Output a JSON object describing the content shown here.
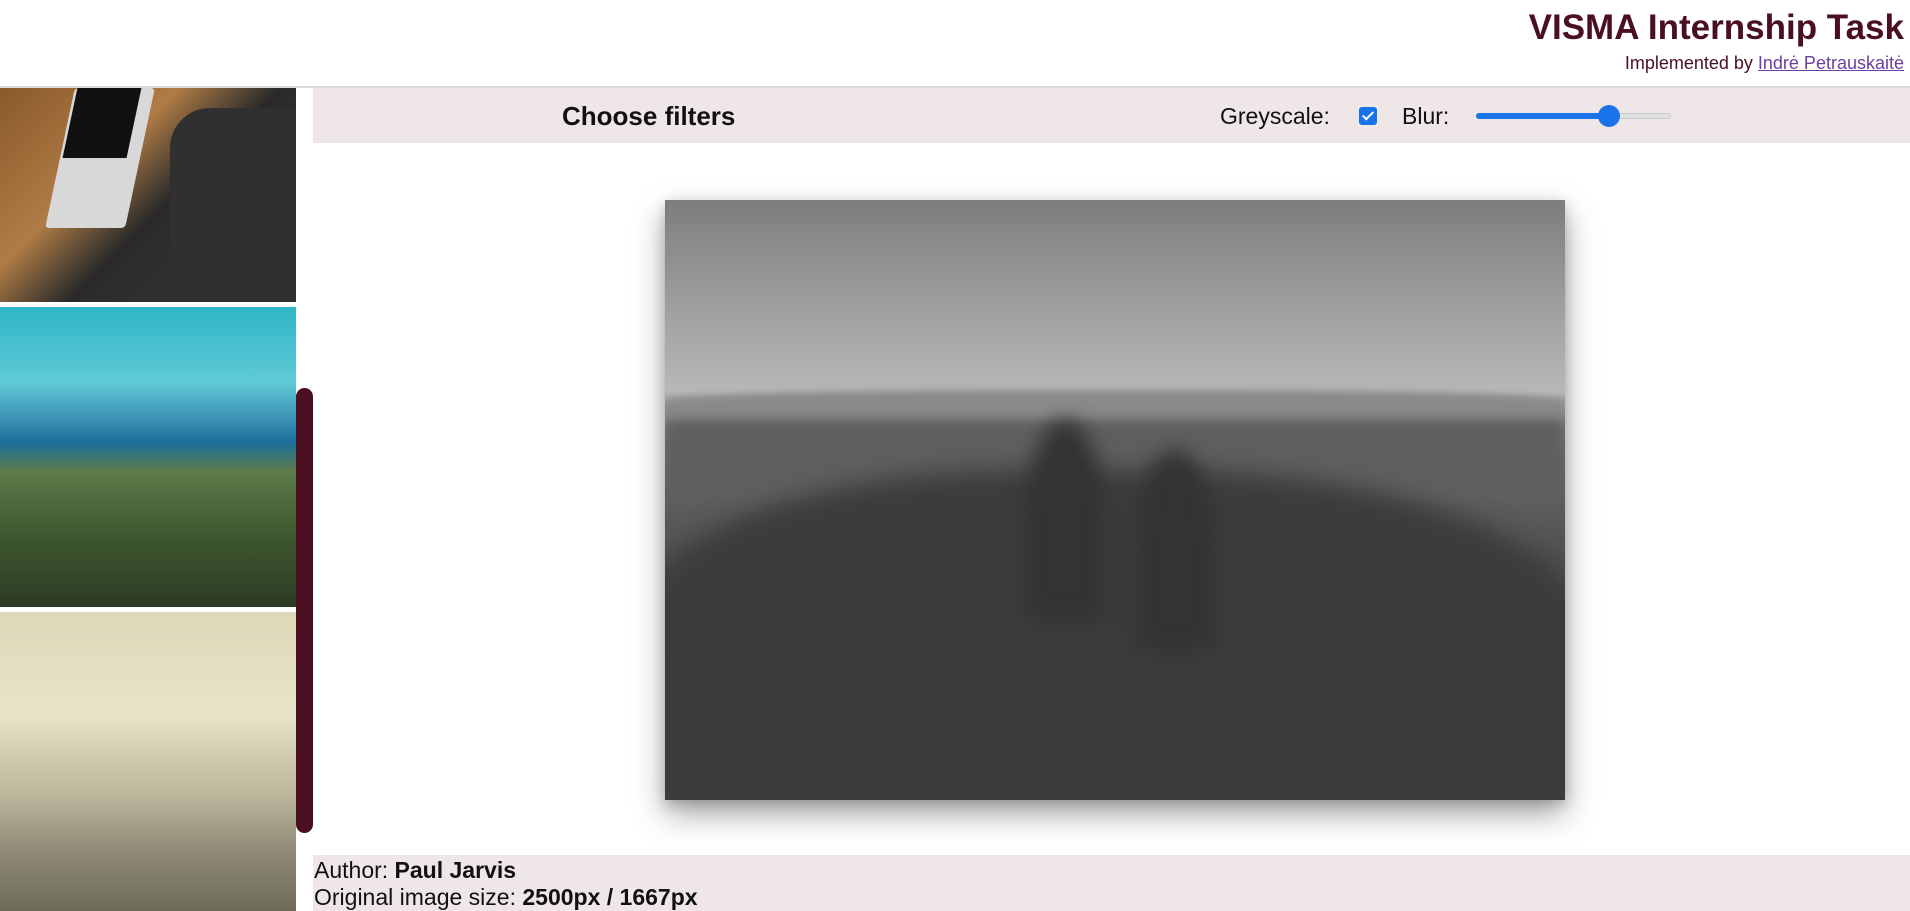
{
  "header": {
    "title": "VISMA Internship Task",
    "implemented_by_label": "Implemented by",
    "author_link": "Indrė Petrauskaitė"
  },
  "sidebar": {
    "thumbnails": [
      {
        "name": "laptop-desk-photo"
      },
      {
        "name": "forest-lake-photo"
      },
      {
        "name": "beach-photo"
      }
    ]
  },
  "filters": {
    "heading": "Choose filters",
    "greyscale_label": "Greyscale:",
    "greyscale_checked": true,
    "blur_label": "Blur:",
    "blur_value_fraction": 0.68
  },
  "image_info": {
    "author_label": "Author:",
    "author_name": "Paul Jarvis",
    "size_label": "Original image size:",
    "size_value": "2500px / 1667px"
  },
  "colors": {
    "brand": "#4a0f20",
    "accent": "#1a73e8",
    "panel_bg": "#efe6e7"
  }
}
